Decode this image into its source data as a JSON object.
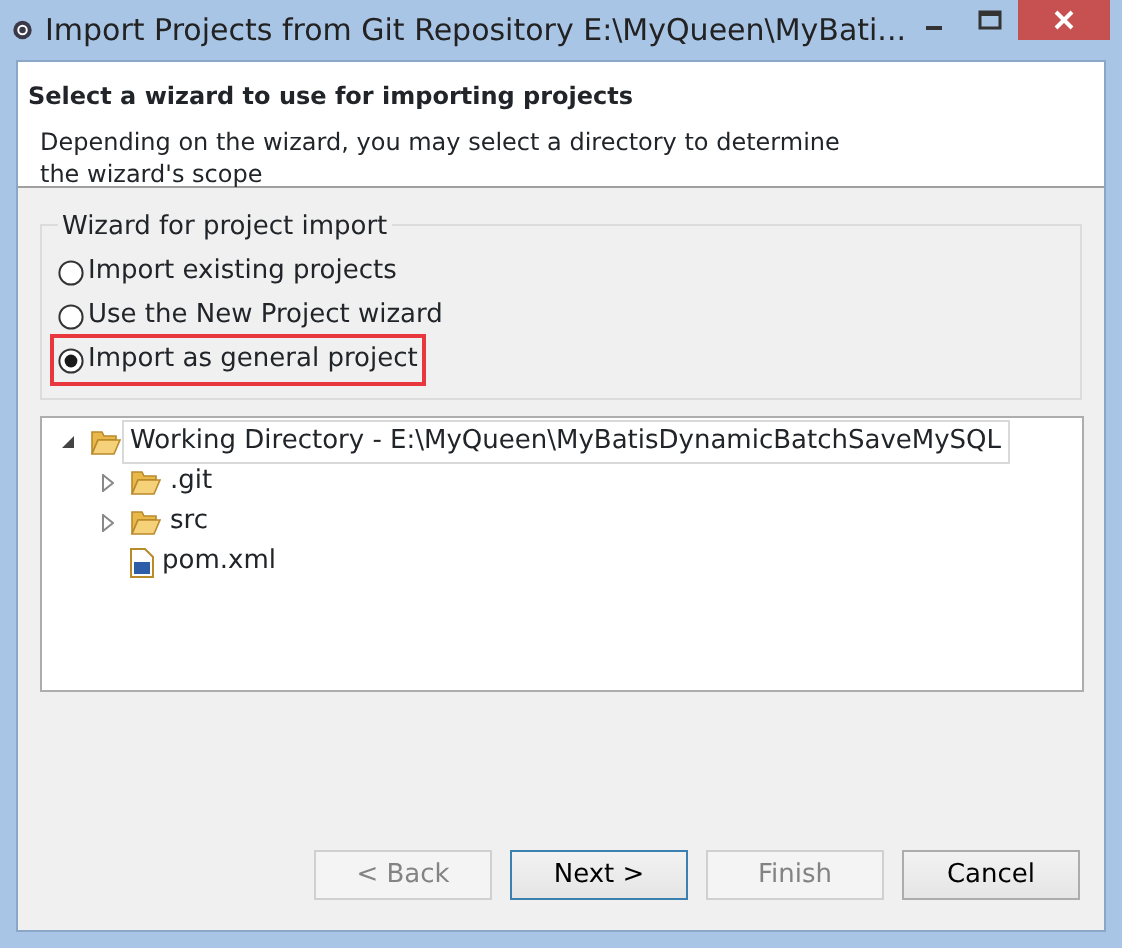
{
  "window": {
    "title": "Import Projects from Git Repository E:\\MyQueen\\MyBati..."
  },
  "header": {
    "title": "Select a wizard to use for importing projects",
    "description": "Depending on the wizard, you may select a directory to determine\nthe wizard's scope"
  },
  "wizard_group": {
    "label": "Wizard for project import",
    "options": [
      {
        "label": "Import existing projects",
        "selected": false,
        "highlighted": false
      },
      {
        "label": "Use the New Project wizard",
        "selected": false,
        "highlighted": false
      },
      {
        "label": "Import as general project",
        "selected": true,
        "highlighted": true
      }
    ]
  },
  "tree": [
    {
      "label": "Working Directory - E:\\MyQueen\\MyBatisDynamicBatchSaveMySQL",
      "kind": "folder",
      "expanded": true,
      "selected": true,
      "children": [
        {
          "label": ".git",
          "kind": "folder",
          "expanded": false,
          "selected": false
        },
        {
          "label": "src",
          "kind": "folder",
          "expanded": false,
          "selected": false
        },
        {
          "label": "pom.xml",
          "kind": "maven-file",
          "selected": false
        }
      ]
    }
  ],
  "buttons": [
    {
      "label": "< Back",
      "disabled": true,
      "default": false
    },
    {
      "label": "Next >",
      "disabled": false,
      "default": true
    },
    {
      "label": "Finish",
      "disabled": true,
      "default": false
    },
    {
      "label": "Cancel",
      "disabled": false,
      "default": false
    }
  ]
}
